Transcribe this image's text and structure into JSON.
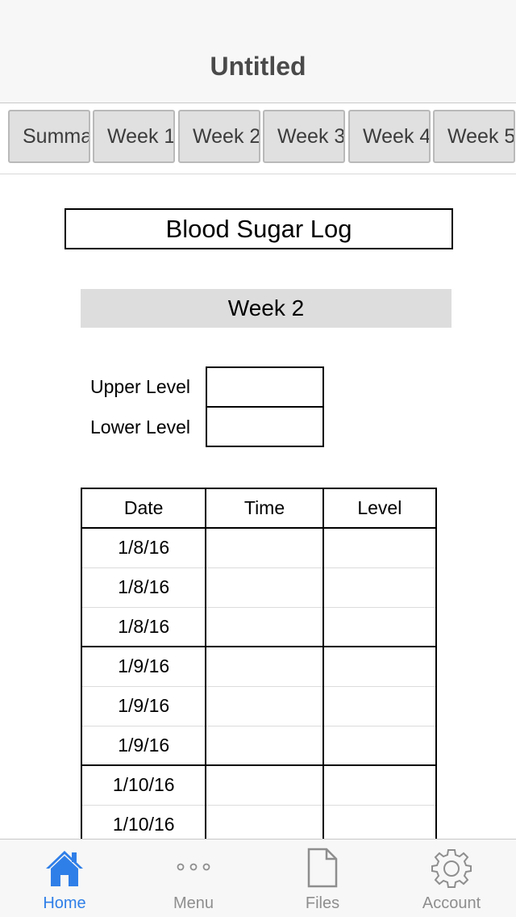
{
  "navbar": {
    "title": "Untitled"
  },
  "tabs": [
    {
      "label": "Summary"
    },
    {
      "label": "Week 1"
    },
    {
      "label": "Week 2"
    },
    {
      "label": "Week 3"
    },
    {
      "label": "Week 4"
    },
    {
      "label": "Week 5"
    }
  ],
  "document": {
    "title": "Blood Sugar Log",
    "week_heading": "Week 2",
    "upper_level_label": "Upper Level",
    "lower_level_label": "Lower Level",
    "upper_level_value": "",
    "lower_level_value": ""
  },
  "log_table": {
    "headers": [
      "Date",
      "Time",
      "Level"
    ],
    "rows": [
      {
        "date": "1/8/16",
        "time": "",
        "level": ""
      },
      {
        "date": "1/8/16",
        "time": "",
        "level": ""
      },
      {
        "date": "1/8/16",
        "time": "",
        "level": ""
      },
      {
        "date": "1/9/16",
        "time": "",
        "level": ""
      },
      {
        "date": "1/9/16",
        "time": "",
        "level": ""
      },
      {
        "date": "1/9/16",
        "time": "",
        "level": ""
      },
      {
        "date": "1/10/16",
        "time": "",
        "level": ""
      },
      {
        "date": "1/10/16",
        "time": "",
        "level": ""
      }
    ]
  },
  "tabbar": {
    "items": [
      {
        "label": "Home",
        "icon": "home-icon",
        "active": true
      },
      {
        "label": "Menu",
        "icon": "ellipsis-icon",
        "active": false
      },
      {
        "label": "Files",
        "icon": "file-icon",
        "active": false
      },
      {
        "label": "Account",
        "icon": "gear-icon",
        "active": false
      }
    ]
  },
  "colors": {
    "accent": "#2f7fe8",
    "inactive": "#8e8e8e"
  }
}
